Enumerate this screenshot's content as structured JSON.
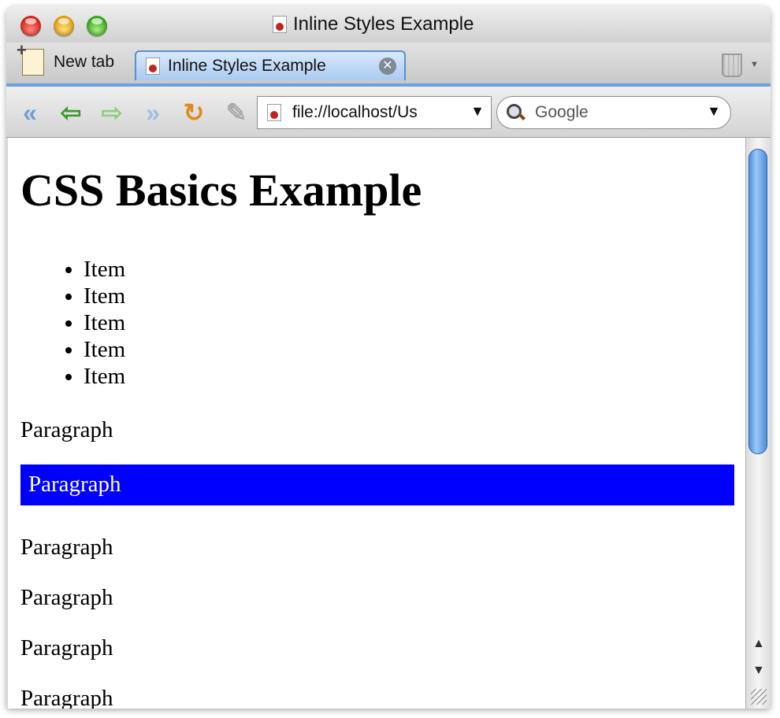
{
  "window": {
    "title": "Inline Styles Example"
  },
  "tabs": {
    "new_tab_label": "New tab",
    "active_tab_label": "Inline Styles Example",
    "close_glyph": "✕"
  },
  "toolbar": {
    "url": "file://localhost/Us",
    "search_placeholder": "Google",
    "dropdown_glyph": "▼",
    "icons": [
      "rewind-icon",
      "back-arrow-icon",
      "forward-arrow-icon",
      "fast-forward-icon",
      "reload-icon",
      "pencil-icon"
    ]
  },
  "page": {
    "heading": "CSS Basics Example",
    "list_items": [
      "Item",
      "Item",
      "Item",
      "Item",
      "Item"
    ],
    "paragraphs": [
      "Paragraph",
      "Paragraph",
      "Paragraph",
      "Paragraph",
      "Paragraph",
      "Paragraph"
    ],
    "highlight_color": "#0000ff",
    "highlight_text_color": "#ffffff"
  },
  "scrollbar": {
    "up_glyph": "▲",
    "down_glyph": "▼"
  }
}
